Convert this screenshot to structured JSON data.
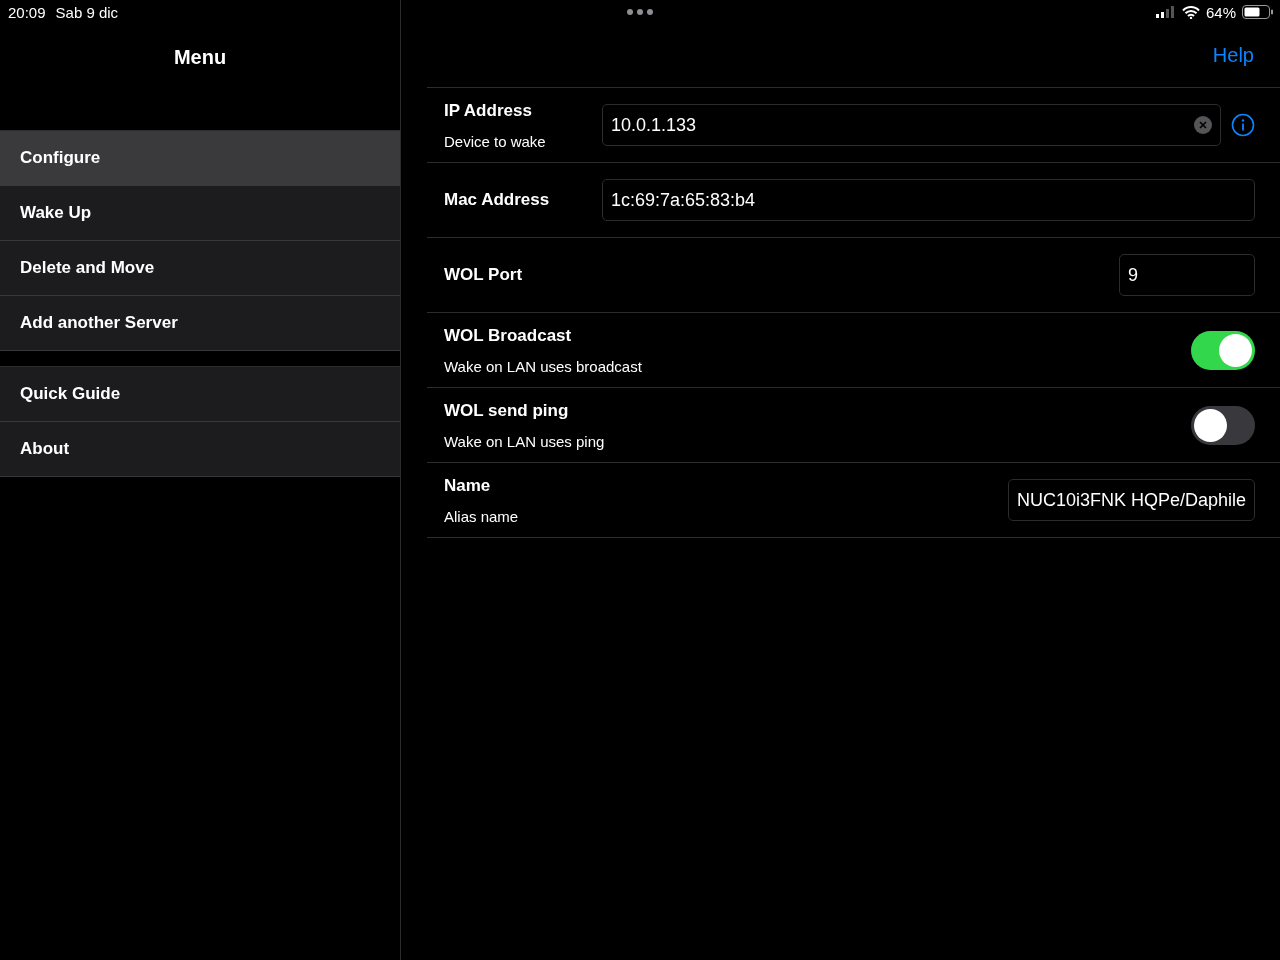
{
  "status_bar": {
    "time": "20:09",
    "date": "Sab 9 dic",
    "battery": "64%"
  },
  "sidebar": {
    "title": "Menu",
    "groups": [
      {
        "items": [
          {
            "label": "Configure",
            "selected": true
          },
          {
            "label": "Wake Up",
            "selected": false
          },
          {
            "label": "Delete and Move",
            "selected": false
          },
          {
            "label": "Add another Server",
            "selected": false
          }
        ]
      },
      {
        "items": [
          {
            "label": "Quick Guide",
            "selected": false
          },
          {
            "label": "About",
            "selected": false
          }
        ]
      }
    ]
  },
  "nav": {
    "help": "Help"
  },
  "rows": [
    {
      "kind": "field",
      "label": "IP Address",
      "subtitle": "Device to wake",
      "value": "10.0.1.133",
      "clearable": true,
      "info": true
    },
    {
      "kind": "field",
      "label": "Mac Address",
      "value": "1c:69:7a:65:83:b4"
    },
    {
      "kind": "short_field",
      "label": "WOL Port",
      "value": "9"
    },
    {
      "kind": "toggle",
      "label": "WOL Broadcast",
      "subtitle": "Wake on LAN uses broadcast",
      "on": true
    },
    {
      "kind": "toggle",
      "label": "WOL send ping",
      "subtitle": "Wake on LAN uses ping",
      "on": false
    },
    {
      "kind": "short_field",
      "label": "Name",
      "subtitle": "Alias name",
      "value": "NUC10i3FNK HQPe/Daphile"
    }
  ]
}
